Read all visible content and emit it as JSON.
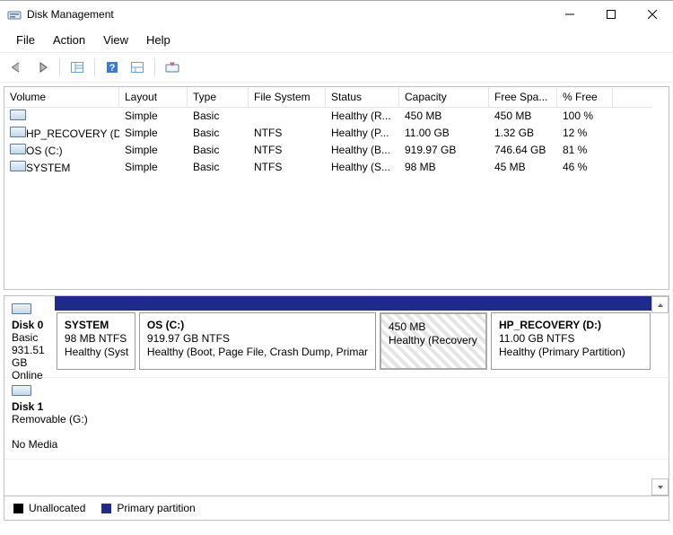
{
  "window": {
    "title": "Disk Management"
  },
  "menu": {
    "file": "File",
    "action": "Action",
    "view": "View",
    "help": "Help"
  },
  "columns": {
    "volume": "Volume",
    "layout": "Layout",
    "type": "Type",
    "fs": "File System",
    "status": "Status",
    "capacity": "Capacity",
    "free": "Free Spa...",
    "pct": "% Free"
  },
  "volumes": [
    {
      "name": "",
      "layout": "Simple",
      "type": "Basic",
      "fs": "",
      "status": "Healthy (R...",
      "capacity": "450 MB",
      "free": "450 MB",
      "pct": "100 %"
    },
    {
      "name": "HP_RECOVERY (D:)",
      "layout": "Simple",
      "type": "Basic",
      "fs": "NTFS",
      "status": "Healthy (P...",
      "capacity": "11.00 GB",
      "free": "1.32 GB",
      "pct": "12 %"
    },
    {
      "name": "OS (C:)",
      "layout": "Simple",
      "type": "Basic",
      "fs": "NTFS",
      "status": "Healthy (B...",
      "capacity": "919.97 GB",
      "free": "746.64 GB",
      "pct": "81 %"
    },
    {
      "name": "SYSTEM",
      "layout": "Simple",
      "type": "Basic",
      "fs": "NTFS",
      "status": "Healthy (S...",
      "capacity": "98 MB",
      "free": "45 MB",
      "pct": "46 %"
    }
  ],
  "disks": {
    "d0": {
      "label": "Disk 0",
      "type": "Basic",
      "size": "931.51 GB",
      "state": "Online",
      "parts": {
        "system": {
          "name": "SYSTEM",
          "size": "98 MB NTFS",
          "status": "Healthy (Syst"
        },
        "os": {
          "name": "OS  (C:)",
          "size": "919.97 GB NTFS",
          "status": "Healthy (Boot, Page File, Crash Dump, Primar"
        },
        "recovery": {
          "name": "",
          "size": "450 MB",
          "status": "Healthy (Recovery"
        },
        "hp": {
          "name": "HP_RECOVERY  (D:)",
          "size": "11.00 GB NTFS",
          "status": "Healthy (Primary Partition)"
        }
      }
    },
    "d1": {
      "label": "Disk 1",
      "type": "Removable (G:)",
      "state": "No Media"
    }
  },
  "legend": {
    "unallocated": "Unallocated",
    "primary": "Primary partition"
  },
  "colors": {
    "primary": "#1f2a8a",
    "unallocated": "#000000"
  }
}
